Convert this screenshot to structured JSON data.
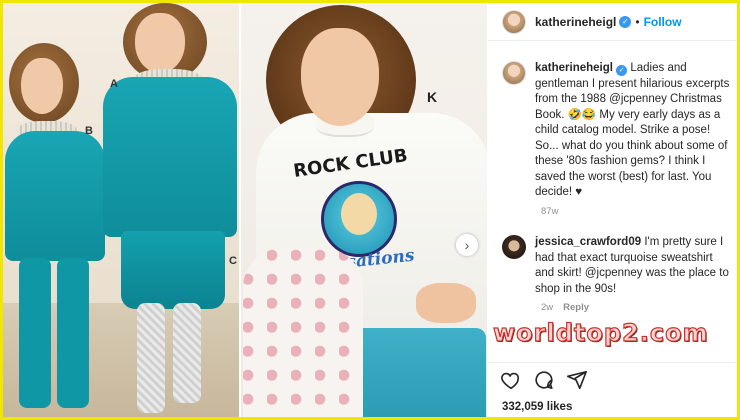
{
  "post": {
    "username": "katherineheigl",
    "follow_label": "Follow",
    "separator": "•",
    "caption": {
      "username": "katherineheigl",
      "text": "Ladies and gentleman I present hilarious excerpts from the 1988 @jcpenney Christmas Book. 🤣😂 My very early days as a child catalog model. Strike a pose! So... what do you think about some of these '80s fashion gems? I think I saved the worst (best) for last. You decide! ♥",
      "time": "87w"
    },
    "comment": {
      "username": "jessica_crawford09",
      "text": "I'm pretty sure I had that exact turquoise sweatshirt and skirt! @jcpenney was the place to shop in the 90s!",
      "time": "2w",
      "reply_label": "Reply"
    },
    "likes": "332,059 likes"
  },
  "photo": {
    "left_labels": [
      "A",
      "B",
      "C"
    ],
    "right_label": "K",
    "shirt_print_top": "ROCK CLUB",
    "shirt_print_bottom": "Sensations"
  },
  "watermark": "worldtop2.com",
  "icons": [
    "verified-badge-icon",
    "chevron-right-icon",
    "heart-icon",
    "comment-icon",
    "share-icon"
  ],
  "colors": {
    "frame": "#f1e600",
    "follow": "#0095f6",
    "verified": "#3897f0",
    "turquoise": "#14a0ae"
  }
}
